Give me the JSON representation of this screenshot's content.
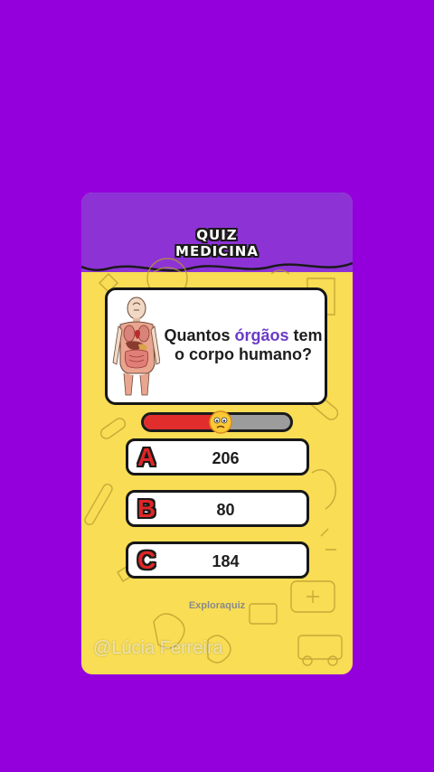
{
  "quiz": {
    "title_line1": "QUIZ",
    "title_line2": "MEDICINA",
    "question_prefix": "Quantos ",
    "question_highlight": "órgãos",
    "question_suffix": " tem o corpo humano?",
    "timer_fraction": 0.52,
    "answers": [
      {
        "letter": "A",
        "text": "206"
      },
      {
        "letter": "B",
        "text": "80"
      },
      {
        "letter": "C",
        "text": "184"
      }
    ],
    "brand": "Exploraquiz"
  },
  "watermark": "@Lúcia Ferreira",
  "colors": {
    "background": "#9400dc",
    "header": "#8d33d6",
    "card": "#f8dd55",
    "highlight": "#6a3bc6",
    "timer_fill": "#e22d2d",
    "letter": "#e02626"
  },
  "icons": {
    "illustration": "human-organs-illustration",
    "timer_emoji": "worried-face-icon"
  }
}
